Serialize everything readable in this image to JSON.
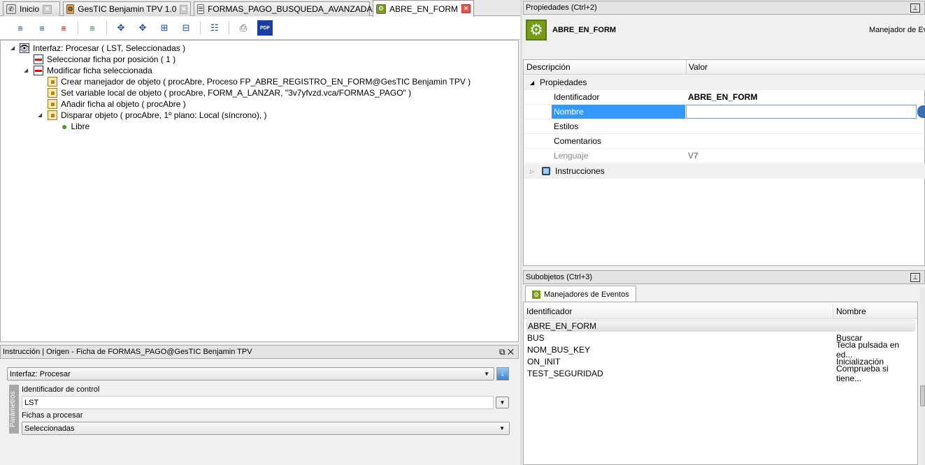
{
  "tabs": [
    {
      "label": "Inicio"
    },
    {
      "label": "GesTIC Benjamin TPV 1.0"
    },
    {
      "label": "FORMAS_PAGO_BUSQUEDA_AVANZADA"
    },
    {
      "label": "ABRE_EN_FORM"
    }
  ],
  "tree": [
    {
      "label": "Interfaz: Procesar ( LST, Seleccionadas )"
    },
    {
      "label": "Seleccionar ficha por posición ( 1 )"
    },
    {
      "label": "Modificar ficha seleccionada"
    },
    {
      "label": "Crear manejador de objeto ( procAbre, Proceso FP_ABRE_REGISTRO_EN_FORM@GesTIC Benjamin TPV )"
    },
    {
      "label": "Set variable local de objeto ( procAbre, FORM_A_LANZAR, \"3v7yfvzd.vca/FORMAS_PAGO\" )"
    },
    {
      "label": "Añadir ficha al objeto ( procAbre )"
    },
    {
      "label": "Disparar objeto ( procAbre, 1º plano: Local (síncrono),  )"
    },
    {
      "label": "Libre"
    }
  ],
  "instruction": {
    "title": "Instrucción | Origen - Ficha de FORMAS_PAGO@GesTIC Benjamin TPV",
    "command": "Interfaz: Procesar",
    "params_label": "Parámetros",
    "control_label": "Identificador de control",
    "control_value": "LST",
    "fichas_label": "Fichas a procesar",
    "fichas_value": "Seleccionadas"
  },
  "properties": {
    "title": "Propiedades (Ctrl+2)",
    "object_name": "ABRE_EN_FORM",
    "object_type": "Manejador de Ev",
    "col_desc": "Descripción",
    "col_value": "Valor",
    "group": "Propiedades",
    "rows": [
      {
        "name": "Identificador",
        "value": "ABRE_EN_FORM"
      },
      {
        "name": "Nombre",
        "value": ""
      },
      {
        "name": "Estilos",
        "value": ""
      },
      {
        "name": "Comentarios",
        "value": ""
      },
      {
        "name": "Lenguaje",
        "value": "V7"
      }
    ],
    "group2": "Instrucciones"
  },
  "subobjects": {
    "title": "Subobjetos (Ctrl+3)",
    "tab": "Manejadores de Eventos",
    "col_id": "Identificador",
    "col_name": "Nombre",
    "rows": [
      {
        "id": "ABRE_EN_FORM",
        "name": ""
      },
      {
        "id": "BUS",
        "name": "Buscar"
      },
      {
        "id": "NOM_BUS_KEY",
        "name": "Tecla pulsada en ed..."
      },
      {
        "id": "ON_INIT",
        "name": "Inicialización"
      },
      {
        "id": "TEST_SEGURIDAD",
        "name": "Comprueba si tiene..."
      }
    ]
  }
}
